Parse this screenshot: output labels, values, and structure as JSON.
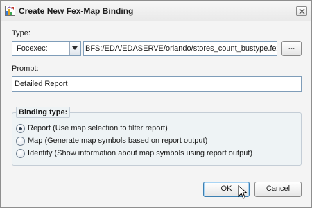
{
  "window": {
    "title": "Create New Fex-Map Binding",
    "icon": "map-binding-app-icon",
    "close_icon": "close-icon"
  },
  "type_section": {
    "label": "Type:",
    "type_select_value": "Focexec:",
    "fex_path": "BFS:/EDA/EDASERVE/orlando/stores_count_bustype.fex",
    "browse_label": "..."
  },
  "prompt_section": {
    "label": "Prompt:",
    "value": "Detailed Report"
  },
  "binding_type": {
    "legend": "Binding type:",
    "selected_index": 0,
    "options": [
      {
        "label": "Report (Use map selection to filter report)"
      },
      {
        "label": "Map (Generate map symbols based on report output)"
      },
      {
        "label": "Identify (Show information about map symbols using report output)"
      }
    ]
  },
  "buttons": {
    "ok": "OK",
    "cancel": "Cancel"
  }
}
